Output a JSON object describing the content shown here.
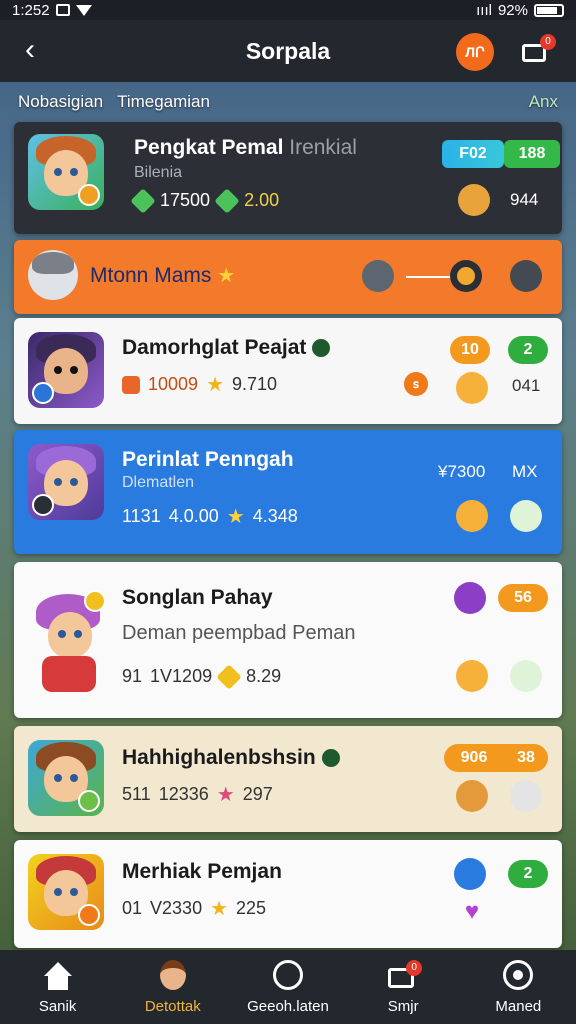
{
  "status": {
    "time": "1:252",
    "battery": "92%",
    "signal": "ıııl"
  },
  "header": {
    "title": "Sorpala",
    "action_label": "ЛՐ",
    "cart_badge": "0"
  },
  "strip": {
    "left1": "Nobasigian",
    "left2": "Timegamian",
    "right": "Anx"
  },
  "cards": [
    {
      "title": "Pengkat Pemal",
      "title_suffix": "Irenkial",
      "subtitle": "Bilenia",
      "stat1": "17500",
      "stat2": "2.00",
      "pill1": "F02",
      "pill2": "188",
      "right_value": "944"
    },
    {
      "title": "Mtonn Mams"
    },
    {
      "title": "Damorhglat Peajat",
      "stat1": "10009",
      "stat2": "9.710",
      "pill1": "10",
      "pill2": "2",
      "right_value": "041",
      "round_label": "ꜱ"
    },
    {
      "title": "Perinlat Penngah",
      "subtitle": "Dlematlen",
      "stat1": "4.0.00",
      "stat_prefix": "1131",
      "stat2": "4.348",
      "right1": "¥7300",
      "right2": "MX"
    },
    {
      "title": "Songlan Pahay",
      "subtitle": "Deman peempbad Peman",
      "stat_prefix": "91",
      "stat1": "1V1209",
      "stat2": "8.29",
      "pill": "56"
    },
    {
      "title": "Hahhighalenbshsin",
      "stat_prefix": "511",
      "stat1": "12336",
      "stat2": "297",
      "pill1": "906",
      "pill2": "38"
    },
    {
      "title": "Merhiak Pemjan",
      "stat_prefix": "01",
      "stat1": "V2330",
      "stat2": "225",
      "pill": "2"
    }
  ],
  "tabs": [
    {
      "label": "Sanik"
    },
    {
      "label": "Detottak"
    },
    {
      "label": "Geeoh.laten"
    },
    {
      "label": "Smjr",
      "badge": "0"
    },
    {
      "label": "Maned"
    }
  ],
  "colors": {
    "accent": "#f26b1d",
    "blue": "#2a7be0",
    "green": "#2fae3f"
  }
}
